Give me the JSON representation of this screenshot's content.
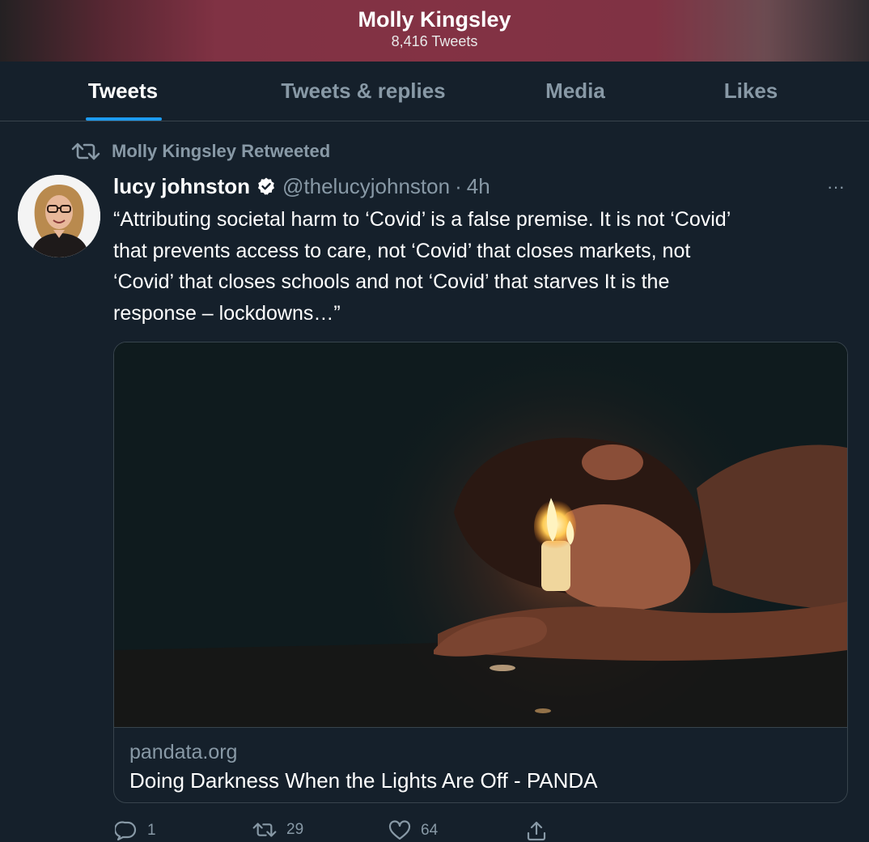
{
  "header": {
    "name": "Molly Kingsley",
    "tweet_count": "8,416 Tweets"
  },
  "tabs": [
    {
      "label": "Tweets",
      "active": true
    },
    {
      "label": "Tweets & replies",
      "active": false
    },
    {
      "label": "Media",
      "active": false
    },
    {
      "label": "Likes",
      "active": false
    }
  ],
  "retweet": {
    "label": "Molly Kingsley Retweeted",
    "icon": "retweet-icon"
  },
  "tweet": {
    "author_name": "lucy johnston",
    "handle": "@thelucyjohnston",
    "separator": "·",
    "time": "4h",
    "text_lines": [
      "“Attributing societal harm to ‘Covid’ is a false premise.  It is not ‘Covid’",
      "that prevents access to care, not ‘Covid’ that closes markets, not",
      "‘Covid’ that closes schools and not ‘Covid’ that starves It is the",
      "response – lockdowns…”"
    ],
    "more_label": "···"
  },
  "card": {
    "domain": "pandata.org",
    "title": "Doing Darkness When the Lights Are Off - PANDA"
  },
  "actions": {
    "reply_count": "1",
    "retweet_count": "29",
    "like_count": "64"
  },
  "colors": {
    "background": "#15202b",
    "secondary_text": "#8899a6",
    "accent": "#1d9bf0",
    "border": "#38444d"
  }
}
